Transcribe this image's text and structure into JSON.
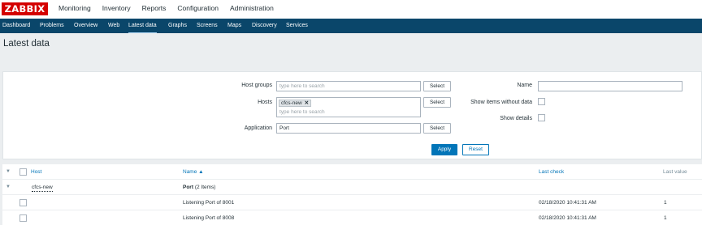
{
  "logo": "ZABBIX",
  "main_menu": [
    "Monitoring",
    "Inventory",
    "Reports",
    "Configuration",
    "Administration"
  ],
  "sub_nav": [
    "Dashboard",
    "Problems",
    "Overview",
    "Web",
    "Latest data",
    "Graphs",
    "Screens",
    "Maps",
    "Discovery",
    "Services"
  ],
  "sub_nav_active": "Latest data",
  "page_title": "Latest data",
  "filter": {
    "host_groups_label": "Host groups",
    "host_groups_placeholder": "type here to search",
    "hosts_label": "Hosts",
    "hosts_tag": "cfcs-new",
    "hosts_placeholder": "type here to search",
    "application_label": "Application",
    "application_value": "Port",
    "select_label": "Select",
    "name_label": "Name",
    "name_value": "",
    "show_without_data_label": "Show items without data",
    "show_details_label": "Show details",
    "apply_label": "Apply",
    "reset_label": "Reset"
  },
  "table": {
    "headers": {
      "host": "Host",
      "name": "Name ▲",
      "last_check": "Last check",
      "last_value": "Last value"
    },
    "group_row": {
      "host": "cfcs-new",
      "app_name": "Port",
      "app_count": "(2 Items)"
    },
    "rows": [
      {
        "name": "Listening Port of 8001",
        "last_check": "02/18/2020 10:41:31 AM",
        "last_value": "1"
      },
      {
        "name": "Listening Port of 8008",
        "last_check": "02/18/2020 10:41:31 AM",
        "last_value": "1"
      }
    ]
  },
  "colors": {
    "logo_red": "#d40000",
    "nav_blue": "#0a466a",
    "link_blue": "#0275b8",
    "page_bg": "#ebeef0"
  }
}
